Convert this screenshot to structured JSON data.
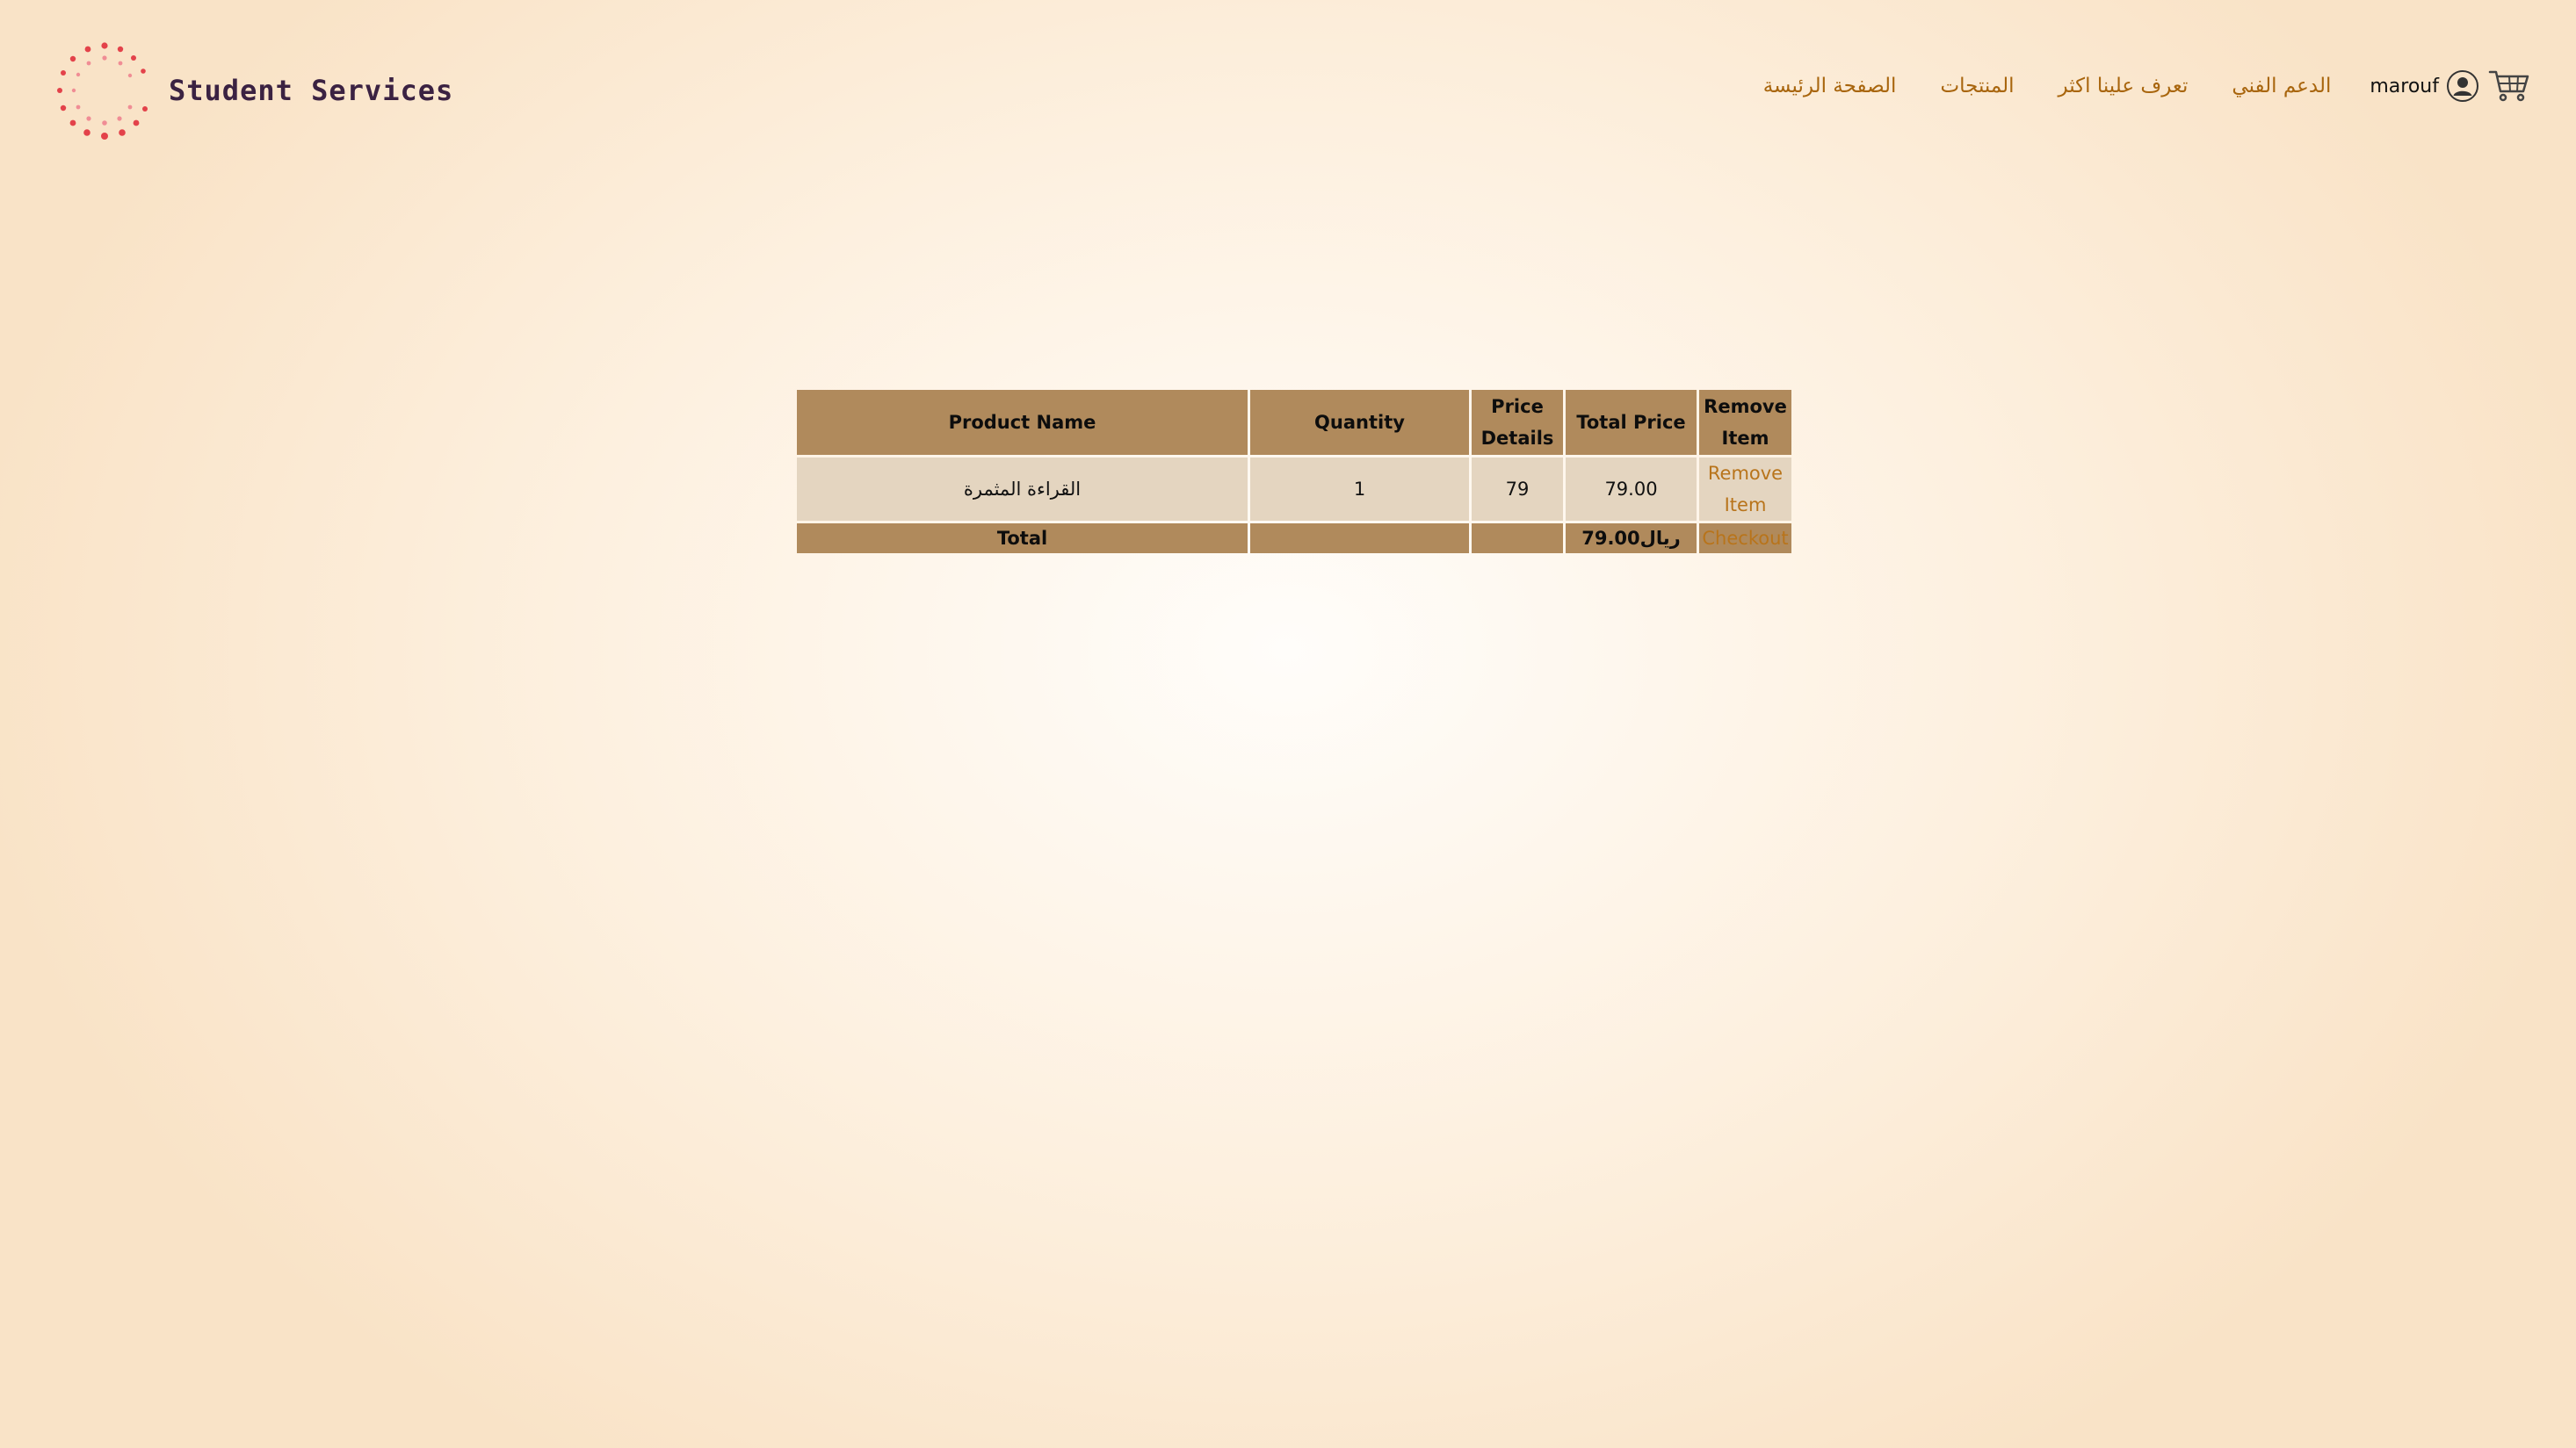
{
  "brand": {
    "name": "Student Services",
    "logo_icon": "dotted-circle-logo",
    "logo_color": "#e3424a"
  },
  "nav": {
    "links": [
      "الصفحة الرئيسة",
      "المنتجات",
      "تعرف علينا اكثر",
      "الدعم الفني"
    ],
    "username": "marouf",
    "user_icon": "user-circle-icon",
    "cart_icon": "shopping-cart-icon",
    "link_color": "#a8650d"
  },
  "cart": {
    "headers": {
      "product_name": "Product Name",
      "quantity": "Quantity",
      "price_details": "Price Details",
      "total_price": "Total Price",
      "remove_item": "Remove Item"
    },
    "rows": [
      {
        "product_name": "القراءة المثمرة",
        "quantity": "1",
        "price_details": "79",
        "total_price": "79.00",
        "remove_label": "Remove Item"
      }
    ],
    "footer": {
      "label": "Total",
      "total": "ريال79.00",
      "checkout_label": "Checkout"
    },
    "header_bg": "#b08a5c",
    "row_bg": "#e4d5c0"
  }
}
